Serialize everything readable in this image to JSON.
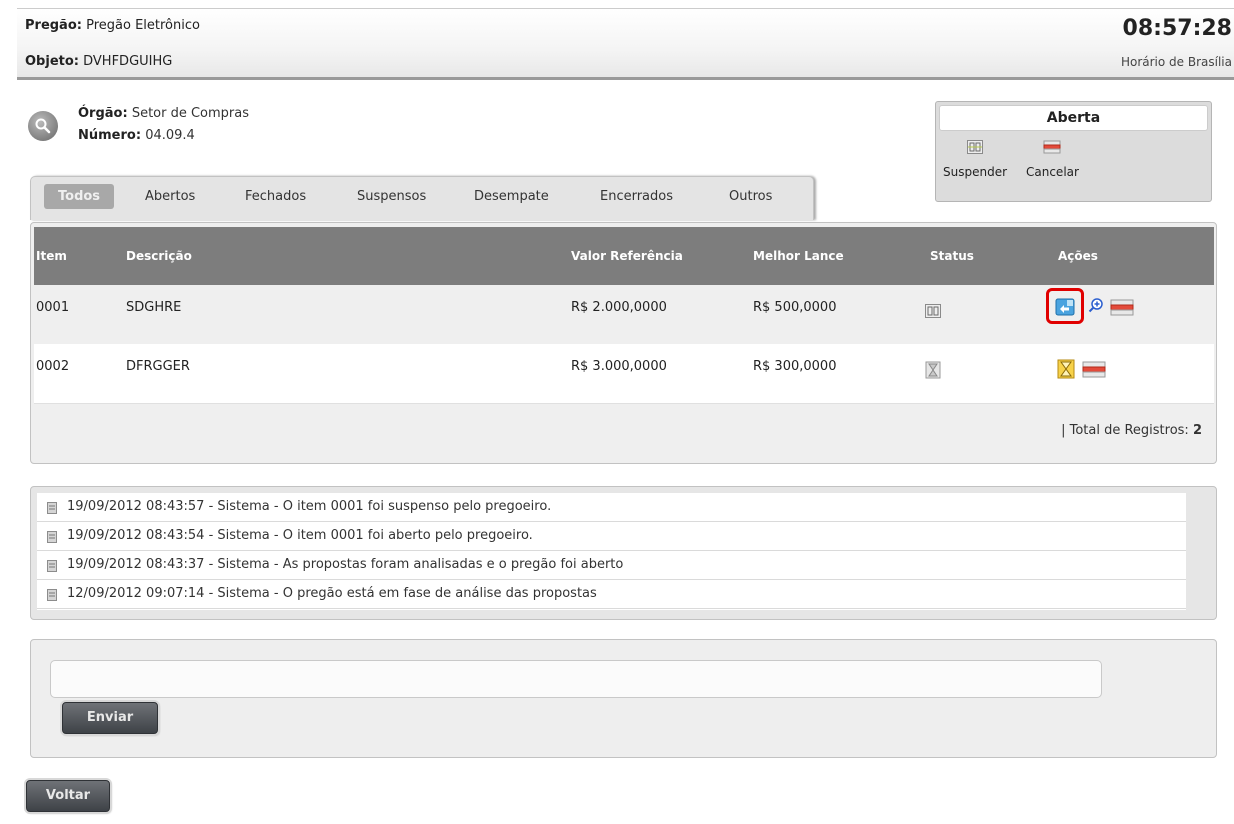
{
  "header": {
    "pregao_label": "Pregão:",
    "pregao_value": "Pregão Eletrônico",
    "objeto_label": "Objeto:",
    "objeto_value": "DVHFDGUIHG",
    "clock": "08:57:28",
    "clock_sub": "Horário de Brasília"
  },
  "info": {
    "orgao_label": "Órgão:",
    "orgao_value": "Setor de Compras",
    "numero_label": "Número:",
    "numero_value": "04.09.4"
  },
  "status_box": {
    "title": "Aberta",
    "suspender": "Suspender",
    "cancelar": "Cancelar"
  },
  "tabs": [
    "Todos",
    "Abertos",
    "Fechados",
    "Suspensos",
    "Desempate",
    "Encerrados",
    "Outros"
  ],
  "table": {
    "headers": [
      "Item",
      "Descrição",
      "Valor Referência",
      "Melhor Lance",
      "Status",
      "Ações"
    ],
    "rows": [
      {
        "item": "0001",
        "descricao": "SDGHRE",
        "valor": "R$ 2.000,0000",
        "lance": "R$ 500,0000",
        "status_icon": "suspended-icon",
        "actions": [
          "reopen-icon",
          "zoom-icon",
          "cancel-icon"
        ]
      },
      {
        "item": "0002",
        "descricao": "DFRGGER",
        "valor": "R$ 3.000,0000",
        "lance": "R$ 300,0000",
        "status_icon": "hourglass-icon",
        "actions": [
          "hourglass-action-icon",
          "cancel-icon"
        ]
      }
    ],
    "total_label": "| Total de Registros:",
    "total_value": "2"
  },
  "log": [
    "19/09/2012 08:43:57 - Sistema - O item 0001 foi suspenso pelo pregoeiro.",
    "19/09/2012 08:43:54 - Sistema - O item 0001 foi aberto pelo pregoeiro.",
    "19/09/2012 08:43:37 - Sistema - As propostas foram analisadas e o pregão foi aberto",
    "12/09/2012 09:07:14 - Sistema - O pregão está em fase de análise das propostas"
  ],
  "message": {
    "input_value": "",
    "send_label": "Enviar"
  },
  "back_label": "Voltar",
  "colors": {
    "table_header": "#7d7d7d",
    "highlight": "#e00000",
    "button_dark": "#45494e"
  }
}
